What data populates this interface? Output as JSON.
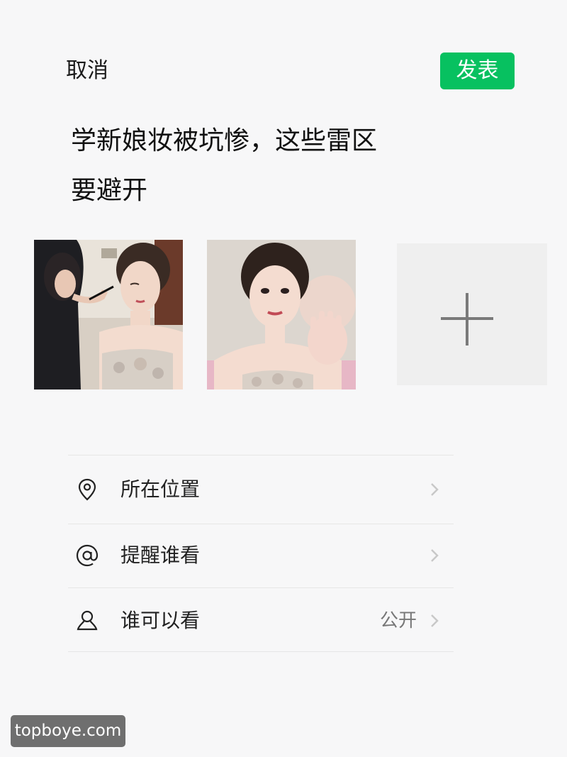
{
  "header": {
    "cancel_label": "取消",
    "publish_label": "发表",
    "publish_color": "#07c160"
  },
  "post": {
    "text_line1": "学新娘妆被坑惨，这些雷区",
    "text_line2": "要避开"
  },
  "images": [
    {
      "name": "makeup-artist-applying-eye-makeup-photo"
    },
    {
      "name": "bride-waving-photo"
    }
  ],
  "add_photo_icon": "plus-icon",
  "options": [
    {
      "icon": "location-pin-icon",
      "label": "所在位置",
      "value": ""
    },
    {
      "icon": "at-sign-icon",
      "label": "提醒谁看",
      "value": ""
    },
    {
      "icon": "person-icon",
      "label": "谁可以看",
      "value": "公开"
    }
  ],
  "watermark": "topboye.com"
}
